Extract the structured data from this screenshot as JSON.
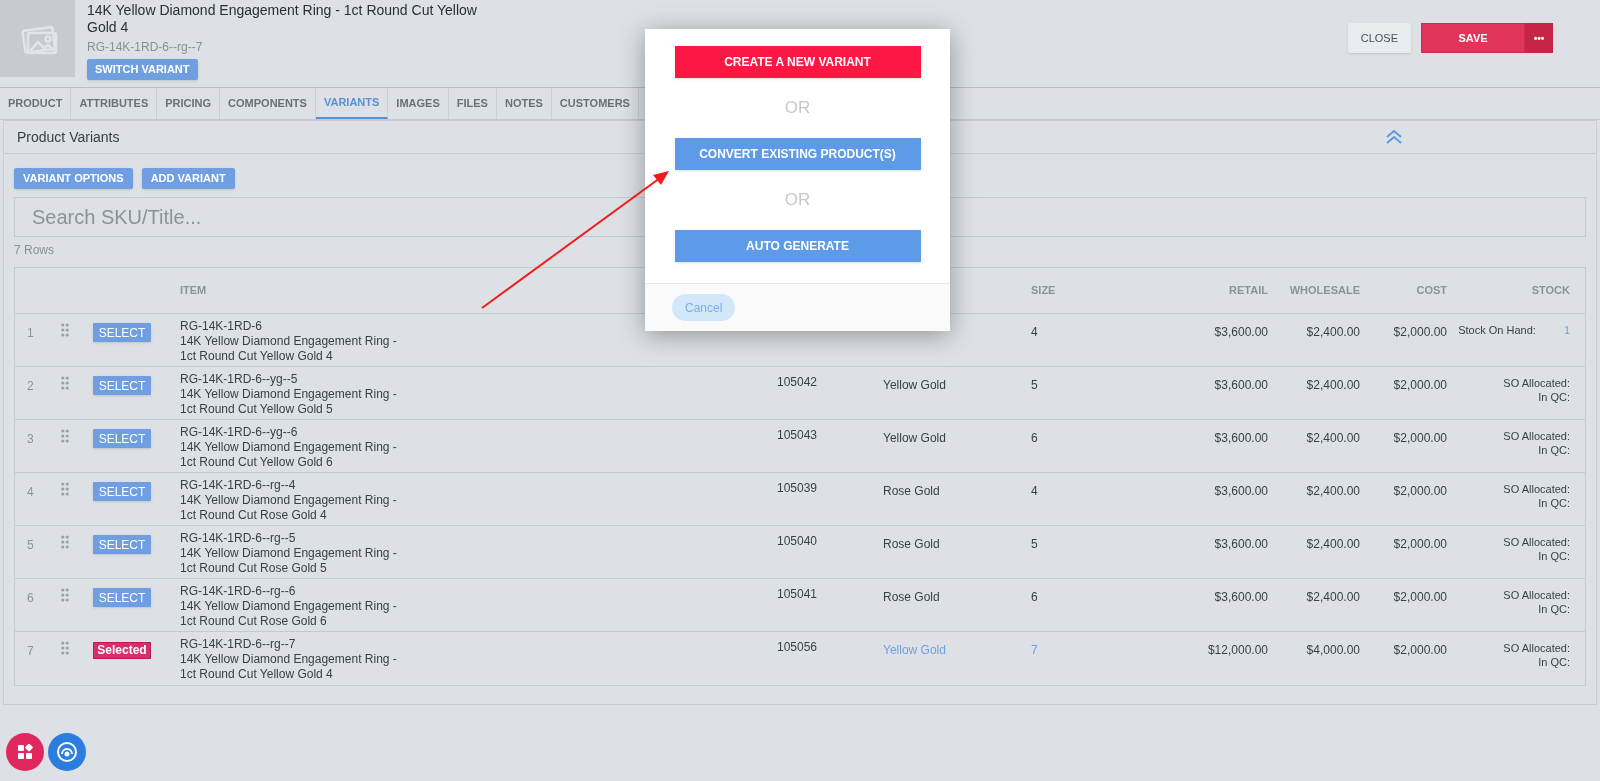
{
  "product": {
    "title": "14K Yellow Diamond Engagement Ring - 1ct Round Cut Yellow Gold 4",
    "sku": "RG-14K-1RD-6--rg--7",
    "switch_button": "SWITCH VARIANT"
  },
  "header_buttons": {
    "close": "CLOSE",
    "save": "SAVE",
    "more": "•••"
  },
  "tabs": [
    {
      "label": "PRODUCT",
      "selected": false
    },
    {
      "label": "ATTRIBUTES",
      "selected": false
    },
    {
      "label": "PRICING",
      "selected": false
    },
    {
      "label": "COMPONENTS",
      "selected": false
    },
    {
      "label": "VARIANTS",
      "selected": true
    },
    {
      "label": "IMAGES",
      "selected": false
    },
    {
      "label": "FILES",
      "selected": false
    },
    {
      "label": "NOTES",
      "selected": false
    },
    {
      "label": "CUSTOMERS",
      "selected": false
    }
  ],
  "panel": {
    "title": "Product Variants",
    "expanded": true,
    "buttons": [
      "VARIANT OPTIONS",
      "ADD VARIANT"
    ],
    "search": {
      "placeholder": "Search SKU/Title..."
    },
    "row_count": "7 Rows"
  },
  "table": {
    "columns": {
      "item": "ITEM",
      "size": "SIZE",
      "retail": "RETAIL",
      "wholesale": "WHOLESALE",
      "cost": "COST",
      "stock": "STOCK"
    },
    "rows": [
      {
        "index": "1",
        "selected": false,
        "button": "SELECT",
        "sku": "RG-14K-1RD-6",
        "name": "14K Yellow Diamond Engagement Ring -\n1ct Round Cut Yellow Gold 4",
        "size": "4",
        "linked": false,
        "retail": "$3,600.00",
        "wholesale": "$2,400.00",
        "cost": "$2,000.00",
        "stock": [
          {
            "label": "Stock On Hand:",
            "value": "1"
          }
        ]
      },
      {
        "index": "2",
        "selected": false,
        "button": "SELECT",
        "sku": "RG-14K-1RD-6--yg--5",
        "name": "14K Yellow Diamond Engagement Ring -\n1ct Round Cut Yellow Gold 5",
        "number": "105042",
        "metal": "Yellow Gold",
        "size": "5",
        "linked": false,
        "retail": "$3,600.00",
        "wholesale": "$2,400.00",
        "cost": "$2,000.00",
        "stock": [
          {
            "label": "SO Allocated:"
          },
          {
            "label": "In QC:"
          }
        ]
      },
      {
        "index": "3",
        "selected": false,
        "button": "SELECT",
        "sku": "RG-14K-1RD-6--yg--6",
        "name": "14K Yellow Diamond Engagement Ring -\n1ct Round Cut Yellow Gold 6",
        "number": "105043",
        "metal": "Yellow Gold",
        "size": "6",
        "linked": false,
        "retail": "$3,600.00",
        "wholesale": "$2,400.00",
        "cost": "$2,000.00",
        "stock": [
          {
            "label": "SO Allocated:"
          },
          {
            "label": "In QC:"
          }
        ]
      },
      {
        "index": "4",
        "selected": false,
        "button": "SELECT",
        "sku": "RG-14K-1RD-6--rg--4",
        "name": "14K Yellow Diamond Engagement Ring -\n1ct Round Cut Rose Gold 4",
        "number": "105039",
        "metal": "Rose Gold",
        "size": "4",
        "linked": false,
        "retail": "$3,600.00",
        "wholesale": "$2,400.00",
        "cost": "$2,000.00",
        "stock": [
          {
            "label": "SO Allocated:"
          },
          {
            "label": "In QC:"
          }
        ]
      },
      {
        "index": "5",
        "selected": false,
        "button": "SELECT",
        "sku": "RG-14K-1RD-6--rg--5",
        "name": "14K Yellow Diamond Engagement Ring -\n1ct Round Cut Rose Gold 5",
        "number": "105040",
        "metal": "Rose Gold",
        "size": "5",
        "linked": false,
        "retail": "$3,600.00",
        "wholesale": "$2,400.00",
        "cost": "$2,000.00",
        "stock": [
          {
            "label": "SO Allocated:"
          },
          {
            "label": "In QC:"
          }
        ]
      },
      {
        "index": "6",
        "selected": false,
        "button": "SELECT",
        "sku": "RG-14K-1RD-6--rg--6",
        "name": "14K Yellow Diamond Engagement Ring -\n1ct Round Cut Rose Gold 6",
        "number": "105041",
        "metal": "Rose Gold",
        "size": "6",
        "linked": false,
        "retail": "$3,600.00",
        "wholesale": "$2,400.00",
        "cost": "$2,000.00",
        "stock": [
          {
            "label": "SO Allocated:"
          },
          {
            "label": "In QC:"
          }
        ]
      },
      {
        "index": "7",
        "selected": true,
        "button": "Selected",
        "sku": "RG-14K-1RD-6--rg--7",
        "name": "14K Yellow Diamond Engagement Ring -\n1ct Round Cut Yellow Gold 4",
        "number": "105056",
        "metal": "Yellow Gold",
        "size": "7",
        "linked": true,
        "retail": "$12,000.00",
        "wholesale": "$4,000.00",
        "cost": "$2,000.00",
        "stock": [
          {
            "label": "SO Allocated:"
          },
          {
            "label": "In QC:"
          }
        ]
      }
    ]
  },
  "modal": {
    "items": [
      {
        "kind": "primary",
        "label": "CREATE A NEW VARIANT"
      },
      {
        "kind": "divider",
        "label": "OR"
      },
      {
        "kind": "secondary",
        "label": "CONVERT EXISTING PRODUCT(S)"
      },
      {
        "kind": "divider",
        "label": "OR"
      },
      {
        "kind": "secondary",
        "label": "AUTO GENERATE"
      }
    ],
    "cancel": "Cancel"
  }
}
